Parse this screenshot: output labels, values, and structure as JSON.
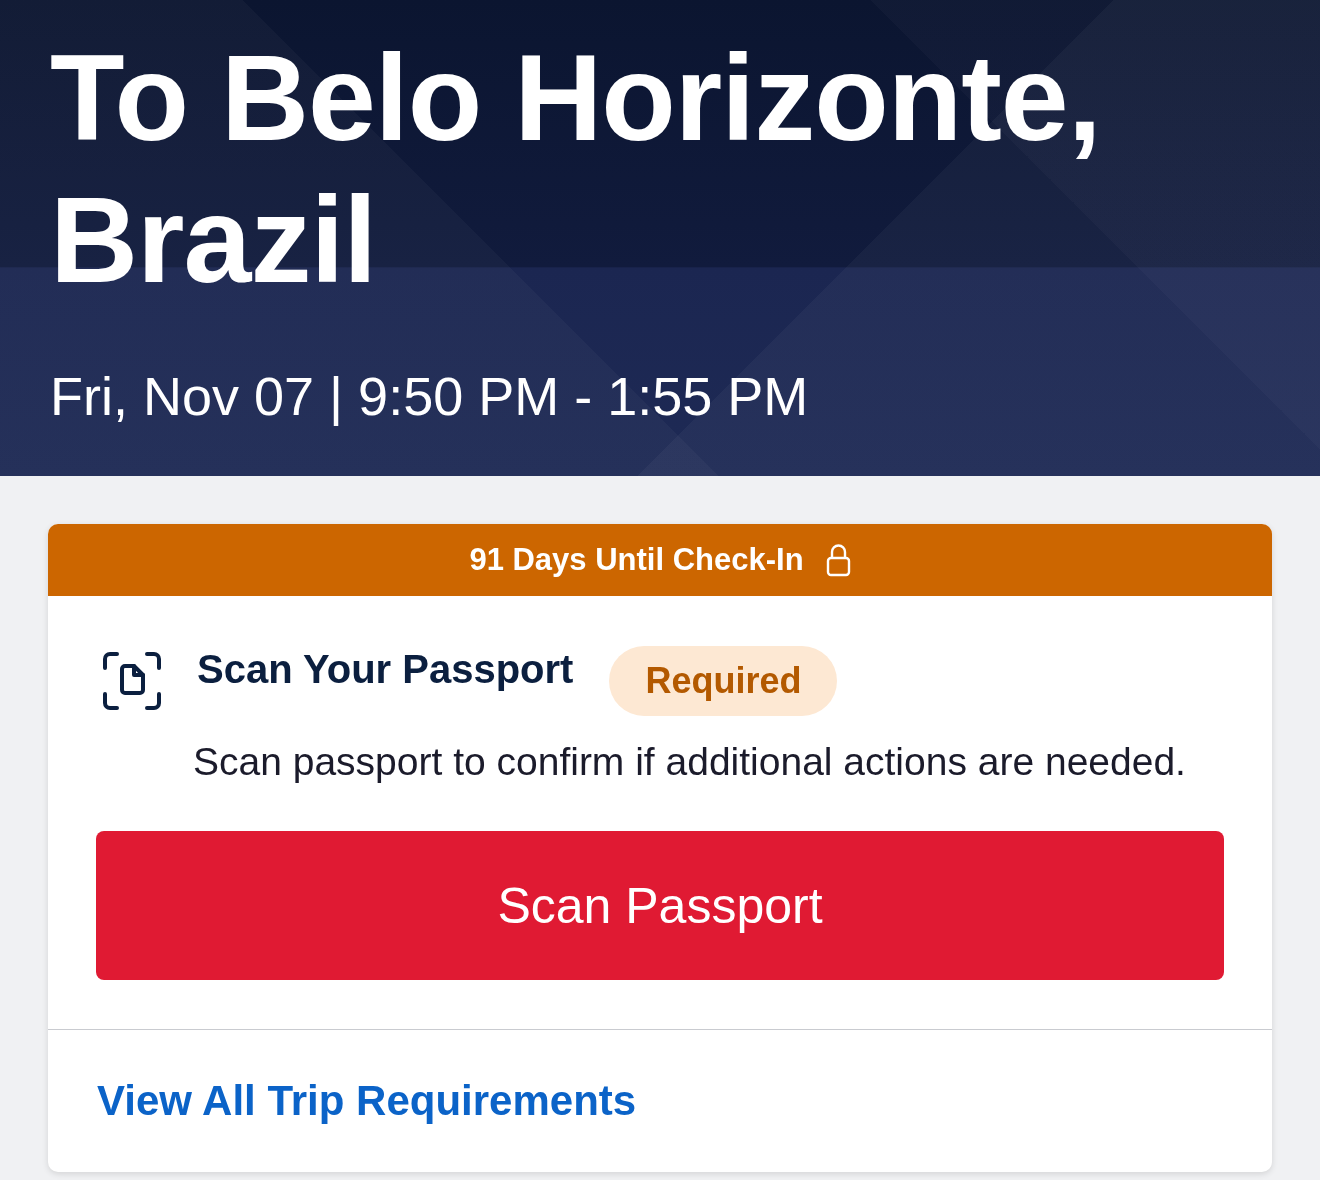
{
  "header": {
    "title": "To Belo Horizonte, Brazil",
    "subtitle": "Fri, Nov 07 | 9:50 PM - 1:55 PM"
  },
  "card": {
    "banner": {
      "text": "91 Days Until Check-In",
      "locked": true
    },
    "task": {
      "title": "Scan Your Passport",
      "badge": "Required",
      "description": "Scan passport to confirm if additional actions are needed.",
      "button": "Scan Passport"
    },
    "link": "View All Trip Requirements"
  }
}
